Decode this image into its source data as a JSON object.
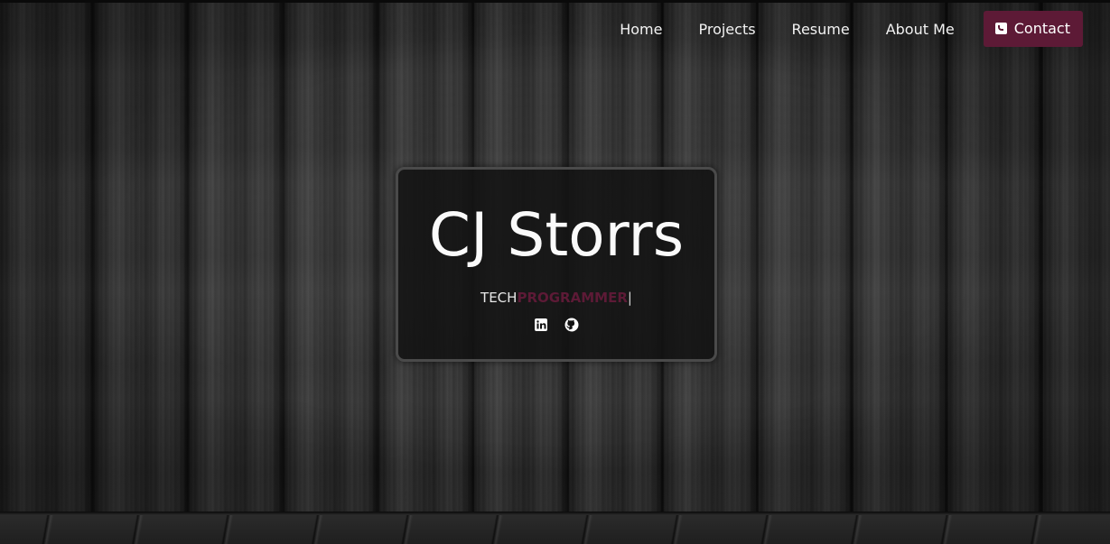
{
  "nav": {
    "items": [
      {
        "label": "Home"
      },
      {
        "label": "Projects"
      },
      {
        "label": "Resume"
      },
      {
        "label": "About Me"
      }
    ],
    "contact": {
      "label": "Contact",
      "icon": "phone-square-icon"
    }
  },
  "hero": {
    "name": "CJ Storrs",
    "tagline_prefix": "TECH",
    "tagline_word": "PROGRAMMER",
    "cursor": "|",
    "socials": [
      {
        "icon": "linkedin-icon"
      },
      {
        "icon": "github-icon"
      }
    ]
  },
  "colors": {
    "accent": "#5d1a36",
    "text": "#f2f2f2"
  }
}
